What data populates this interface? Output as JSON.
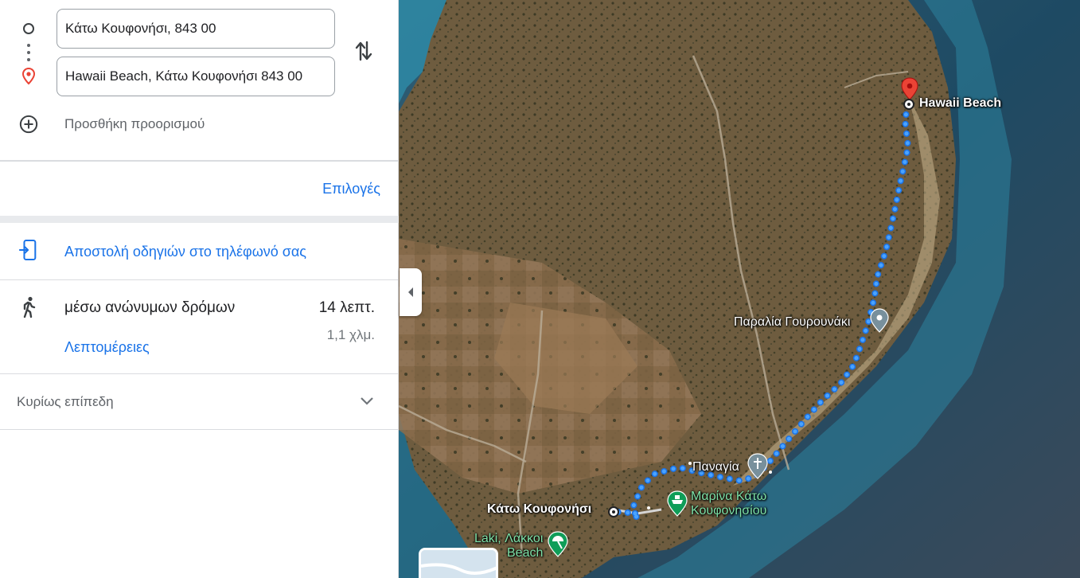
{
  "directions": {
    "origin": "Κάτω Κουφονήσι, 843 00",
    "destination": "Hawaii Beach, Κάτω Κουφονήσι 843 00",
    "add_destination": "Προσθήκη προορισμού",
    "options": "Επιλογές",
    "send_to_phone": "Αποστολή οδηγιών στο τηλέφωνό σας",
    "route": {
      "via": "μέσω ανώνυμων δρόμων",
      "duration": "14 λεπτ.",
      "distance": "1,1 χλμ.",
      "details": "Λεπτομέρειες"
    },
    "terrain": "Κυρίως επίπεδη"
  },
  "map": {
    "labels": {
      "destination": "Hawaii Beach",
      "gourounaki": "Παραλία Γουρουνάκι",
      "panagia": "Παναγία",
      "origin": "Κάτω Κουφονήσι",
      "marina": "Μαρίνα Κάτω Κουφονησίου",
      "marina_line1": "Μαρίνα Κάτω",
      "marina_line2": "Κουφονησίου",
      "laki_line1": "Laki, Λάκκοι",
      "laki_line2": "Beach"
    },
    "colors": {
      "route": "#1a73e8",
      "route_dot": "#4285f4",
      "destination_pin": "#ea4335",
      "sea": "#1e4a63",
      "land": "#6b5a3c"
    }
  },
  "icons": {
    "origin": "origin-circle-icon",
    "destination": "destination-pin-icon",
    "swap": "swap-arrows-icon",
    "add": "add-circle-icon",
    "phone": "send-to-phone-icon",
    "walk": "walking-person-icon",
    "chevron": "chevron-down-icon",
    "collapse": "chevron-left-icon"
  }
}
